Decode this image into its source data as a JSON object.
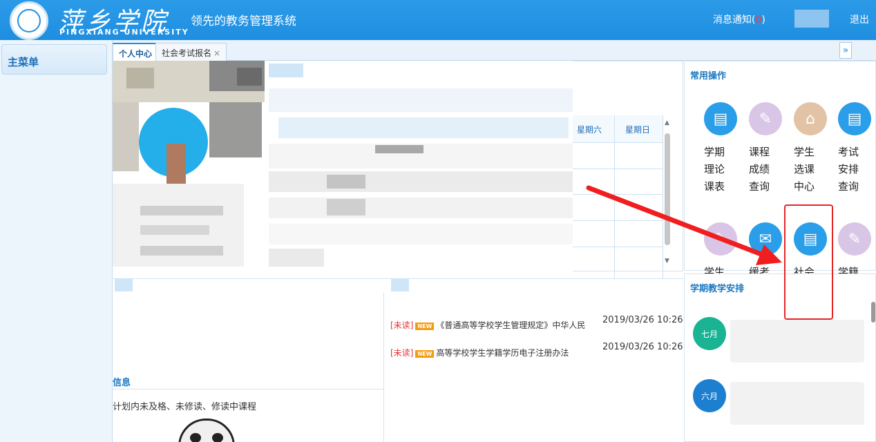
{
  "header": {
    "logo_cn": "萍乡学院",
    "logo_en": "PINGXIANG UNIVERSITY",
    "slogan": "领先的教务管理系统",
    "notify_label": "消息通知(",
    "notify_count": "0",
    "notify_close": ")",
    "logout": "退出"
  },
  "sidebar": {
    "title": "主菜单"
  },
  "tabs": [
    {
      "label": "个人中心",
      "active": true
    },
    {
      "label": "社会考试报名",
      "close": "×"
    }
  ],
  "tab_more": "»",
  "schedule": {
    "day6": "星期六",
    "day7": "星期日"
  },
  "quick_ops": {
    "title": "常用操作",
    "items": [
      {
        "label": "学期理论课表",
        "icon": "chat-icon",
        "color": "blue"
      },
      {
        "label": "课程成绩查询",
        "icon": "feather-icon",
        "color": "purple"
      },
      {
        "label": "学生选课中心",
        "icon": "building-icon",
        "color": "brown"
      },
      {
        "label": "考试安排查询",
        "icon": "chat-icon",
        "color": "blue"
      },
      {
        "label": "学生评价",
        "icon": "feather-icon",
        "color": "purple"
      },
      {
        "label": "缓考申请",
        "icon": "mail-icon",
        "color": "blue"
      },
      {
        "label": "社会考试报名",
        "icon": "chat-icon",
        "color": "blue"
      },
      {
        "label": "学籍信息管理",
        "icon": "feather-icon",
        "color": "purple"
      }
    ]
  },
  "news": [
    {
      "unread": "[未读]",
      "tag": "NEW",
      "title": "《普通高等学校学生管理规定》中华人民",
      "date": "2019/03/26 10:26"
    },
    {
      "unread": "[未读]",
      "tag": "NEW",
      "title": "高等学校学生学籍学历电子注册办法",
      "date": "2019/03/26 10:26"
    }
  ],
  "info": {
    "title": "信息",
    "text": "计划内未及格、未修读、修读中课程"
  },
  "semester": {
    "title": "学期教学安排",
    "months": [
      "七月",
      "六月"
    ]
  },
  "colors": {
    "header": "#1f8ee0",
    "highlight": "#e52626",
    "accent": "#1a78c2"
  }
}
